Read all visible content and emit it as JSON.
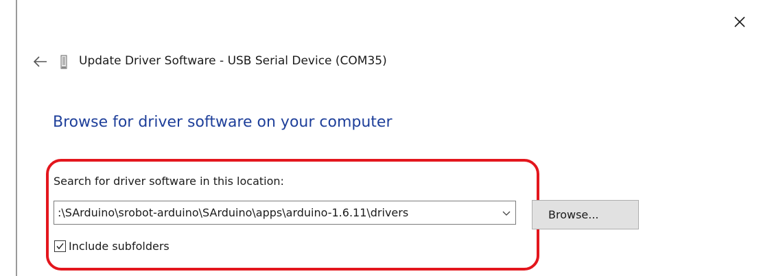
{
  "window": {
    "title": "Update Driver Software - USB Serial Device (COM35)",
    "close_icon": "close-icon",
    "back_icon": "back-arrow-icon",
    "device_icon": "usb-device-icon"
  },
  "main": {
    "heading": "Browse for driver software on your computer",
    "location_label": "Search for driver software in this location:",
    "path_value": ":\\SArduino\\srobot-arduino\\SArduino\\apps\\arduino-1.6.11\\drivers",
    "browse_label": "Browse...",
    "include_subfolders_label": "Include subfolders",
    "include_subfolders_checked": true
  },
  "colors": {
    "heading": "#1e3f9a",
    "highlight": "#e3161d",
    "button_bg": "#e1e1e1"
  }
}
